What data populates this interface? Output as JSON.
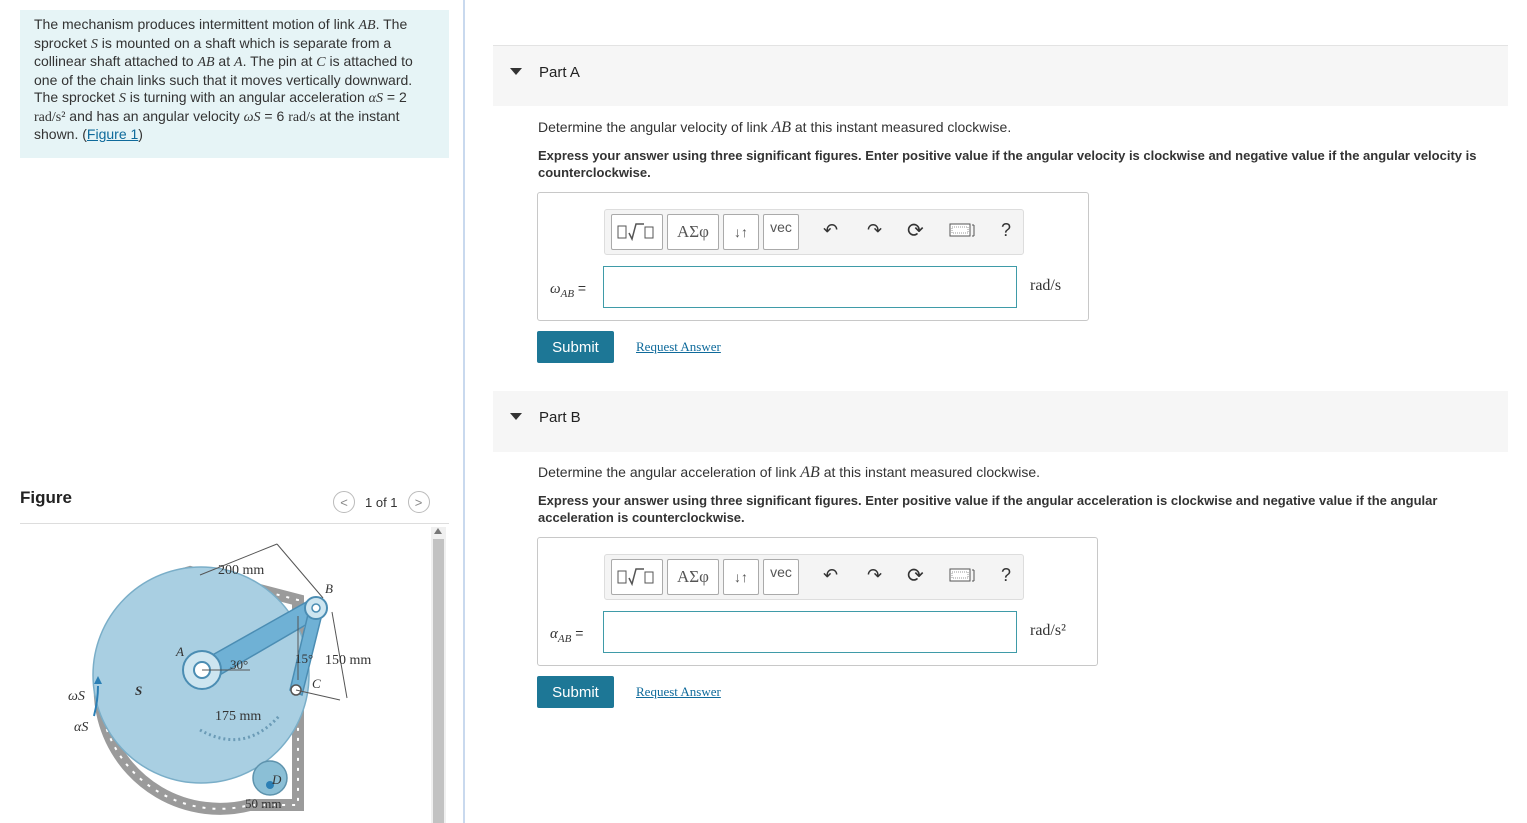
{
  "problem": {
    "text_1": "The mechanism produces intermittent motion of link ",
    "AB": "AB",
    "text_2": ". The sprocket ",
    "S": "S",
    "text_3": " is mounted on a shaft which is separate from a collinear shaft attached to ",
    "text_4": " at ",
    "A": "A",
    "text_5": ". The pin at ",
    "C": "C",
    "text_6": " is attached to one of the chain links such that it moves vertically downward. The sprocket ",
    "text_7": " is turning with an angular acceleration ",
    "alpha_s": "αS",
    "text_8": " = 2 ",
    "accel_unit": "rad/s²",
    "text_9": " and has an angular velocity ",
    "omega_s": "ωS",
    "text_10": " = 6 ",
    "vel_unit": "rad/s",
    "text_11": " at the instant shown. (",
    "figure_link": "Figure 1",
    "text_12": ")"
  },
  "figure": {
    "label": "Figure",
    "pager": "1 of 1",
    "prev_symbol": "<",
    "next_symbol": ">",
    "dim_200": "200 mm",
    "dim_150": "150 mm",
    "dim_175": "175 mm",
    "dim_50": "50 mm",
    "angle_30": "30°",
    "angle_15": "15°",
    "pt_A": "A",
    "pt_B": "B",
    "pt_C": "C",
    "pt_D": "D",
    "pt_S": "S",
    "omega": "ωS",
    "alpha": "αS"
  },
  "toolbar": {
    "greek": "ΑΣφ",
    "arrows": "↓↑",
    "vec": "vec",
    "help": "?"
  },
  "partA": {
    "title": "Part A",
    "question_pre": "Determine the angular velocity of link ",
    "question_var": "AB",
    "question_post": " at this instant measured clockwise.",
    "instruction": "Express your answer using three significant figures. Enter positive value if the angular velocity is clockwise and negative value if the angular velocity is counterclockwise.",
    "var_symbol": "ω",
    "var_sub": "AB",
    "var_eq": " =",
    "input_value": "",
    "unit": "rad/s",
    "submit": "Submit",
    "request": "Request Answer"
  },
  "partB": {
    "title": "Part B",
    "question_pre": "Determine the angular acceleration of link ",
    "question_var": "AB",
    "question_post": " at this instant measured clockwise.",
    "instruction": "Express your answer using three significant figures. Enter positive value if the angular acceleration is clockwise and negative value if the angular acceleration is counterclockwise.",
    "var_symbol": "α",
    "var_sub": "AB",
    "var_eq": " =",
    "input_value": "",
    "unit": "rad/s²",
    "submit": "Submit",
    "request": "Request Answer"
  }
}
